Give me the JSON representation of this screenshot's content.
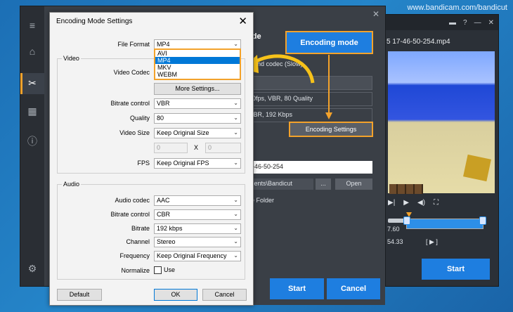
{
  "watermark": "www.bandicam.com/bandicut",
  "right_panel": {
    "filename": "5 17-46-50-254.mp4",
    "time_value": "7.60",
    "time_value2": "54.33",
    "bracket": "[ ▶ ]",
    "start_label": "Start",
    "titlebar_icons": [
      "folder-icon",
      "help-icon",
      "minimize-icon",
      "close-icon"
    ]
  },
  "middle_panel": {
    "mode_title": "ode",
    "encoding_mode_label": "Encoding mode",
    "codec_text": "y and codec (Slow)",
    "bitrate_text": "00fps, VBR, 80 Quality",
    "audio_text": "CBR, 192 Kbps",
    "encoding_settings_label": "Encoding Settings",
    "filename_value": "7-46-50-254",
    "path_value": "ments\\Bandicut",
    "dots_label": "...",
    "open_label": "Open",
    "folder_text": "re Folder",
    "start_label": "Start",
    "cancel_label": "Cancel"
  },
  "dialog": {
    "title": "Encoding Mode Settings",
    "file_format_label": "File Format",
    "file_format_value": "MP4",
    "format_options": [
      "AVI",
      "MP4",
      "MKV",
      "WEBM"
    ],
    "format_selected_index": 1,
    "video_group": "Video",
    "video_codec_label": "Video Codec",
    "more_settings": "More Settings...",
    "bitrate_control_label": "Bitrate control",
    "bitrate_control_value": "VBR",
    "quality_label": "Quality",
    "quality_value": "80",
    "video_size_label": "Video Size",
    "video_size_value": "Keep Original Size",
    "size_w": "0",
    "size_x": "X",
    "size_h": "0",
    "fps_label": "FPS",
    "fps_value": "Keep Original FPS",
    "audio_group": "Audio",
    "audio_codec_label": "Audio codec",
    "audio_codec_value": "AAC",
    "audio_bitrate_control_label": "Bitrate control",
    "audio_bitrate_control_value": "CBR",
    "bitrate_label": "Bitrate",
    "bitrate_value": "192 kbps",
    "channel_label": "Channel",
    "channel_value": "Stereo",
    "frequency_label": "Frequency",
    "frequency_value": "Keep Original Frequency",
    "normalize_label": "Normalize",
    "use_label": "Use",
    "default_label": "Default",
    "ok_label": "OK",
    "cancel_label": "Cancel"
  },
  "colors": {
    "accent_blue": "#1e7ee0",
    "highlight_orange": "#f3a22b",
    "arrow_yellow": "#f6c21a"
  }
}
